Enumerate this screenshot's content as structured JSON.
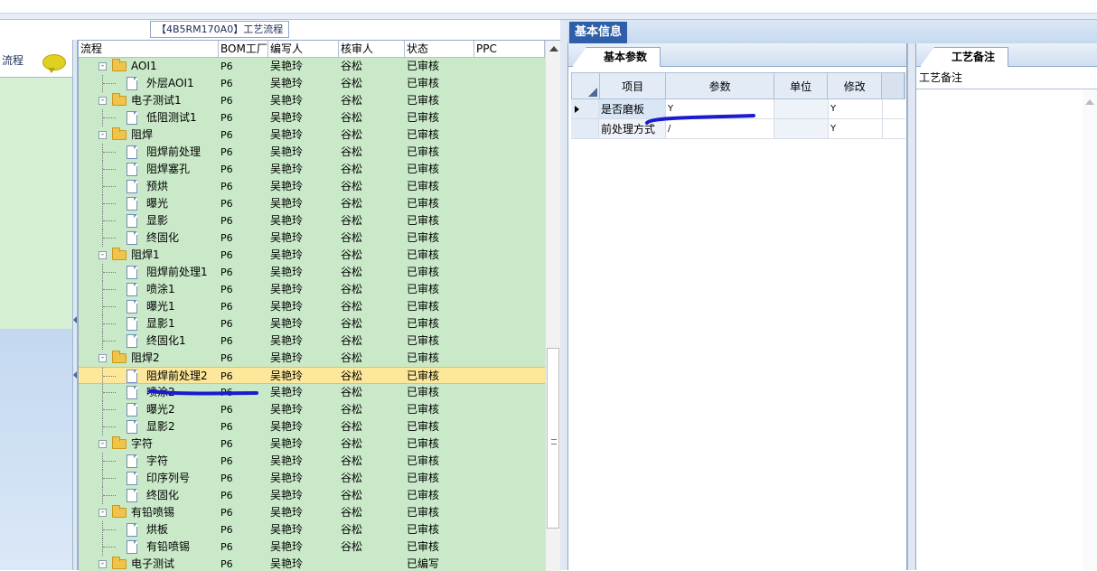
{
  "left_nav": {
    "label": "流程",
    "icon": "chat-bubble-icon"
  },
  "tree_panel": {
    "title": "【4B5RM170A0】工艺流程",
    "columns": [
      "流程",
      "BOM工厂",
      "编写人",
      "核审人",
      "状态",
      "PPC"
    ],
    "rows": [
      {
        "name": "AOI1",
        "level": 0,
        "type": "folder",
        "factory": "P6",
        "writer": "吴艳玲",
        "reviewer": "谷松",
        "status": "已审核"
      },
      {
        "name": "外层AOI1",
        "level": 1,
        "type": "doc",
        "factory": "P6",
        "writer": "吴艳玲",
        "reviewer": "谷松",
        "status": "已审核"
      },
      {
        "name": "电子测试1",
        "level": 0,
        "type": "folder",
        "factory": "P6",
        "writer": "吴艳玲",
        "reviewer": "谷松",
        "status": "已审核"
      },
      {
        "name": "低阻测试1",
        "level": 1,
        "type": "doc",
        "factory": "P6",
        "writer": "吴艳玲",
        "reviewer": "谷松",
        "status": "已审核"
      },
      {
        "name": "阻焊",
        "level": 0,
        "type": "folder",
        "factory": "P6",
        "writer": "吴艳玲",
        "reviewer": "谷松",
        "status": "已审核"
      },
      {
        "name": "阻焊前处理",
        "level": 1,
        "type": "doc",
        "factory": "P6",
        "writer": "吴艳玲",
        "reviewer": "谷松",
        "status": "已审核"
      },
      {
        "name": "阻焊塞孔",
        "level": 1,
        "type": "doc",
        "factory": "P6",
        "writer": "吴艳玲",
        "reviewer": "谷松",
        "status": "已审核"
      },
      {
        "name": "预烘",
        "level": 1,
        "type": "doc",
        "factory": "P6",
        "writer": "吴艳玲",
        "reviewer": "谷松",
        "status": "已审核"
      },
      {
        "name": "曝光",
        "level": 1,
        "type": "doc",
        "factory": "P6",
        "writer": "吴艳玲",
        "reviewer": "谷松",
        "status": "已审核"
      },
      {
        "name": "显影",
        "level": 1,
        "type": "doc",
        "factory": "P6",
        "writer": "吴艳玲",
        "reviewer": "谷松",
        "status": "已审核"
      },
      {
        "name": "终固化",
        "level": 1,
        "type": "doc",
        "factory": "P6",
        "writer": "吴艳玲",
        "reviewer": "谷松",
        "status": "已审核"
      },
      {
        "name": "阻焊1",
        "level": 0,
        "type": "folder",
        "factory": "P6",
        "writer": "吴艳玲",
        "reviewer": "谷松",
        "status": "已审核"
      },
      {
        "name": "阻焊前处理1",
        "level": 1,
        "type": "doc",
        "factory": "P6",
        "writer": "吴艳玲",
        "reviewer": "谷松",
        "status": "已审核"
      },
      {
        "name": "喷涂1",
        "level": 1,
        "type": "doc",
        "factory": "P6",
        "writer": "吴艳玲",
        "reviewer": "谷松",
        "status": "已审核"
      },
      {
        "name": "曝光1",
        "level": 1,
        "type": "doc",
        "factory": "P6",
        "writer": "吴艳玲",
        "reviewer": "谷松",
        "status": "已审核"
      },
      {
        "name": "显影1",
        "level": 1,
        "type": "doc",
        "factory": "P6",
        "writer": "吴艳玲",
        "reviewer": "谷松",
        "status": "已审核"
      },
      {
        "name": "终固化1",
        "level": 1,
        "type": "doc",
        "factory": "P6",
        "writer": "吴艳玲",
        "reviewer": "谷松",
        "status": "已审核"
      },
      {
        "name": "阻焊2",
        "level": 0,
        "type": "folder",
        "factory": "P6",
        "writer": "吴艳玲",
        "reviewer": "谷松",
        "status": "已审核"
      },
      {
        "name": "阻焊前处理2",
        "level": 1,
        "type": "doc",
        "factory": "P6",
        "writer": "吴艳玲",
        "reviewer": "谷松",
        "status": "已审核",
        "selected": true
      },
      {
        "name": "喷涂2",
        "level": 1,
        "type": "doc",
        "factory": "P6",
        "writer": "吴艳玲",
        "reviewer": "谷松",
        "status": "已审核"
      },
      {
        "name": "曝光2",
        "level": 1,
        "type": "doc",
        "factory": "P6",
        "writer": "吴艳玲",
        "reviewer": "谷松",
        "status": "已审核"
      },
      {
        "name": "显影2",
        "level": 1,
        "type": "doc",
        "factory": "P6",
        "writer": "吴艳玲",
        "reviewer": "谷松",
        "status": "已审核"
      },
      {
        "name": "字符",
        "level": 0,
        "type": "folder",
        "factory": "P6",
        "writer": "吴艳玲",
        "reviewer": "谷松",
        "status": "已审核"
      },
      {
        "name": "字符",
        "level": 1,
        "type": "doc",
        "factory": "P6",
        "writer": "吴艳玲",
        "reviewer": "谷松",
        "status": "已审核"
      },
      {
        "name": "印序列号",
        "level": 1,
        "type": "doc",
        "factory": "P6",
        "writer": "吴艳玲",
        "reviewer": "谷松",
        "status": "已审核"
      },
      {
        "name": "终固化",
        "level": 1,
        "type": "doc",
        "factory": "P6",
        "writer": "吴艳玲",
        "reviewer": "谷松",
        "status": "已审核"
      },
      {
        "name": "有铅喷锡",
        "level": 0,
        "type": "folder",
        "factory": "P6",
        "writer": "吴艳玲",
        "reviewer": "谷松",
        "status": "已审核"
      },
      {
        "name": "烘板",
        "level": 1,
        "type": "doc",
        "factory": "P6",
        "writer": "吴艳玲",
        "reviewer": "谷松",
        "status": "已审核"
      },
      {
        "name": "有铅喷锡",
        "level": 1,
        "type": "doc",
        "factory": "P6",
        "writer": "吴艳玲",
        "reviewer": "谷松",
        "status": "已审核"
      },
      {
        "name": "电子测试",
        "level": 0,
        "type": "folder",
        "factory": "P6",
        "writer": "吴艳玲",
        "reviewer": "",
        "status": "已编写"
      }
    ]
  },
  "basic_info": {
    "tab": "基本信息",
    "params_tab": "基本参数",
    "columns": [
      "项目",
      "参数",
      "单位",
      "修改"
    ],
    "rows": [
      {
        "item": "是否磨板",
        "param": "Y",
        "unit": "",
        "modify": "Y",
        "current": true
      },
      {
        "item": "前处理方式",
        "param": "/",
        "unit": "",
        "modify": "Y",
        "current": false
      }
    ]
  },
  "notes": {
    "tab": "工艺备注",
    "header": "工艺备注"
  },
  "colors": {
    "tree_bg": "#c9e9c9",
    "selected_row": "#fde79a",
    "accent": "#2f5fa8",
    "annotation": "#1a1ad0"
  }
}
